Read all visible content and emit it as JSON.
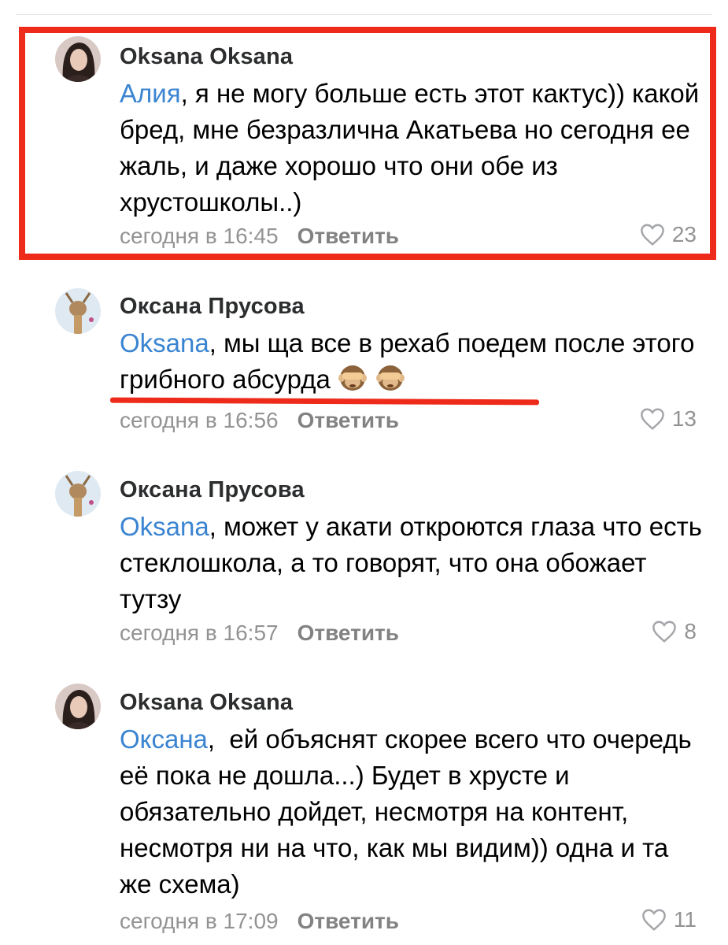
{
  "comments": [
    {
      "author": "Oksana Oksana",
      "mention": "Алия",
      "text": ", я не могу больше есть этот кактус)) какой бред, мне безразлична Акатьева но сегодня ее жаль, и даже хорошо что они обе из хрустошколы..)",
      "timestamp": "сегодня в 16:45",
      "reply_label": "Ответить",
      "likes": "23"
    },
    {
      "author": "Оксана Прусова",
      "mention": "Oksana",
      "text": ", мы ща все в рехаб поедем после этого грибного абсурда",
      "emoji_icons": [
        "see-no-evil-monkey-icon",
        "see-no-evil-monkey-icon"
      ],
      "timestamp": "сегодня в 16:56",
      "reply_label": "Ответить",
      "likes": "13"
    },
    {
      "author": "Оксана Прусова",
      "mention": "Oksana",
      "text": ", может у акати откроются глаза что есть стеклошкола, а то говорят, что она обожает тутзу",
      "timestamp": "сегодня в 16:57",
      "reply_label": "Ответить",
      "likes": "8"
    },
    {
      "author": "Oksana Oksana",
      "mention": "Оксана",
      "text": ",  ей объяснят скорее всего что очередь её пока не дошла...) Будет в хрусте и обязательно дойдет, несмотря на контент, несмотря ни на что, как мы видим)) одна и та же схема)",
      "timestamp": "сегодня в 17:09",
      "reply_label": "Ответить",
      "likes": "11"
    }
  ],
  "colors": {
    "mention": "#3a84d1",
    "highlight": "#ee2b1b",
    "meta": "#939393"
  }
}
